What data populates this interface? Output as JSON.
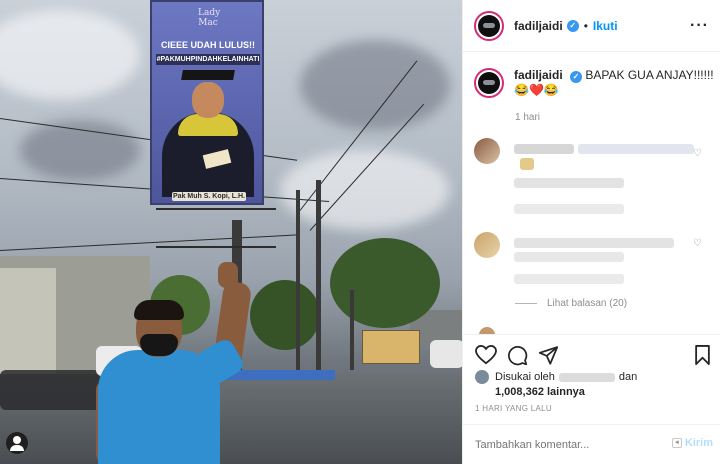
{
  "photo": {
    "billboard": {
      "signature": "Lady Mac",
      "headline": "CIEEE UDAH LULUS!!",
      "hashtag": "#PAKMUHPINDAHKELAINHATI",
      "name_plate": "Pak Muh S. Kopi, L.H."
    },
    "user_tag_icon": "person-icon"
  },
  "post": {
    "username": "fadiljaidi",
    "follow_label": "Ikuti",
    "more_label": "···",
    "caption_text": "BAPAK GUA ANJAY!!!!!!😂❤️😂",
    "caption_time": "1 hari",
    "view_replies_label": "Lihat balasan (20)",
    "liked_by_prefix": "Disukai oleh",
    "liked_by_and": "dan",
    "liked_by_count": "1,008,362 lainnya",
    "timestamp": "1 HARI YANG LALU",
    "comment_placeholder": "Tambahkan komentar...",
    "post_label": "Kirim"
  },
  "icons": {
    "like": "heart-icon",
    "comment": "comment-icon",
    "share": "share-icon",
    "save": "bookmark-icon",
    "verified": "verified-badge-icon"
  },
  "colors": {
    "accent": "#0095f6",
    "verified": "#3897f0",
    "text": "#262626",
    "muted": "#8e8e8e"
  }
}
